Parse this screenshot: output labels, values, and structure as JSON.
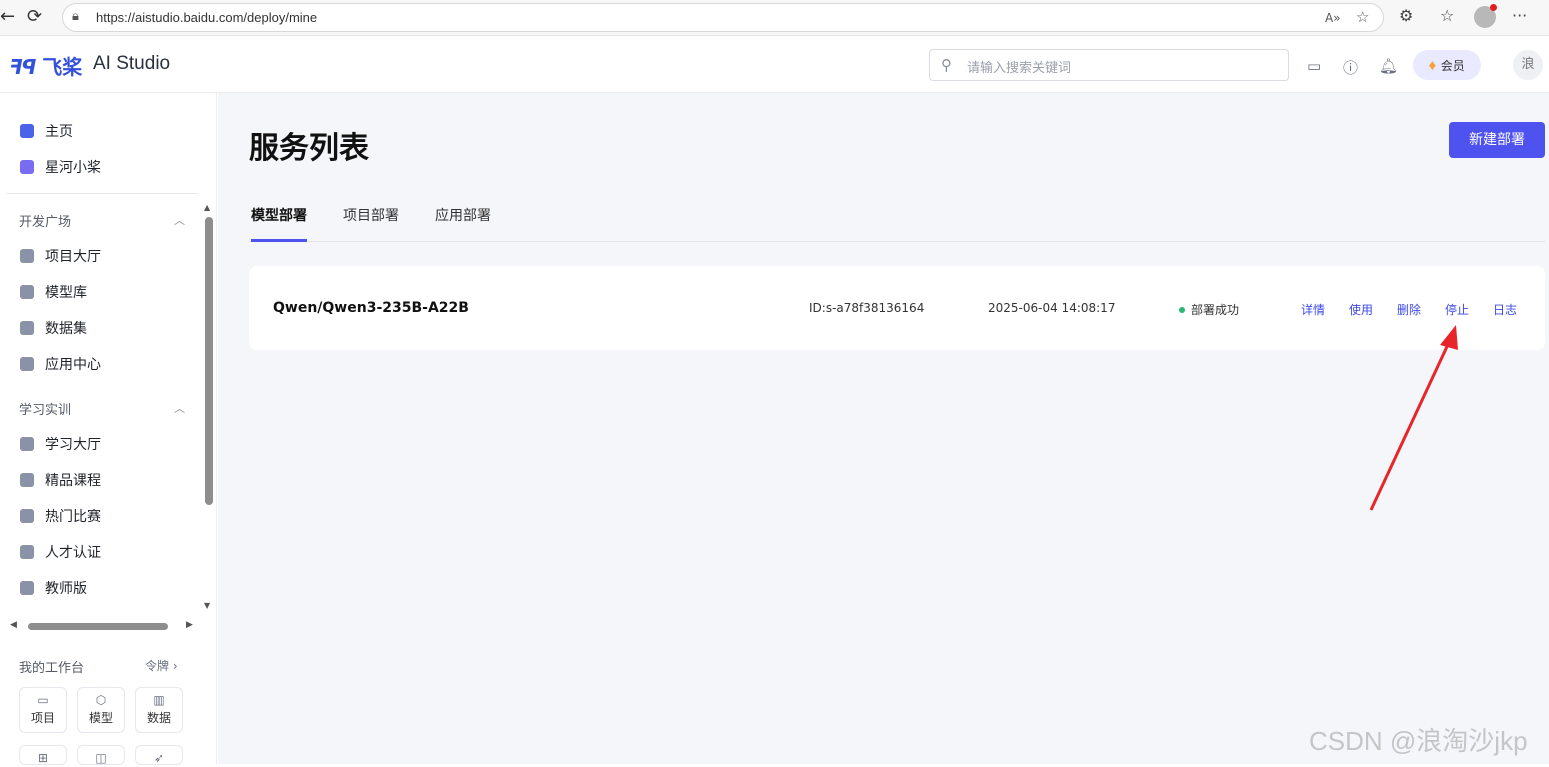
{
  "browser": {
    "url": "https://aistudio.baidu.com/deploy/mine",
    "back_glyph": "←",
    "reload_glyph": "⟳",
    "read_aloud_glyph": "A»",
    "star_glyph": "☆",
    "extensions_glyph": "⚙",
    "favorites_glyph": "☆",
    "more_glyph": "···"
  },
  "header": {
    "logo_mark": "ꟻꟼ",
    "logo_cn": "飞桨",
    "logo_title": "AI Studio",
    "search_placeholder": "请输入搜索关键词",
    "vip_label": "会员",
    "user_avatar_text": "浪"
  },
  "sidebar": {
    "top_items": [
      {
        "label": "主页",
        "icon": "home-icon"
      },
      {
        "label": "星河小桨",
        "icon": "assistant-icon"
      }
    ],
    "section_dev": {
      "title": "开发广场",
      "items": [
        {
          "label": "项目大厅",
          "icon": "project-hall-icon"
        },
        {
          "label": "模型库",
          "icon": "model-library-icon"
        },
        {
          "label": "数据集",
          "icon": "dataset-icon"
        },
        {
          "label": "应用中心",
          "icon": "app-center-icon"
        }
      ]
    },
    "section_learn": {
      "title": "学习实训",
      "items": [
        {
          "label": "学习大厅",
          "icon": "learning-hall-icon"
        },
        {
          "label": "精品课程",
          "icon": "course-icon"
        },
        {
          "label": "热门比赛",
          "icon": "trophy-icon"
        },
        {
          "label": "人才认证",
          "icon": "certification-icon"
        },
        {
          "label": "教师版",
          "icon": "teacher-icon"
        }
      ]
    },
    "workspace": {
      "title": "我的工作台",
      "link": "令牌",
      "tiles": [
        {
          "label": "项目",
          "icon": "folder-icon"
        },
        {
          "label": "模型",
          "icon": "cube-icon"
        },
        {
          "label": "数据",
          "icon": "bar-chart-icon"
        }
      ]
    }
  },
  "main": {
    "page_title": "服务列表",
    "new_button": "新建部署",
    "tabs": [
      {
        "label": "模型部署",
        "active": true
      },
      {
        "label": "项目部署",
        "active": false
      },
      {
        "label": "应用部署",
        "active": false
      }
    ],
    "deployment": {
      "name": "Qwen/Qwen3-235B-A22B",
      "id": "ID:s-a78f38136164",
      "time": "2025-06-04 14:08:17",
      "status": "部署成功",
      "status_color": "#2bb673",
      "actions": [
        "详情",
        "使用",
        "删除",
        "停止",
        "日志"
      ]
    }
  },
  "annotation": {
    "arrow_color": "#e8262a"
  },
  "watermark": "CSDN @浪淘沙jkp"
}
